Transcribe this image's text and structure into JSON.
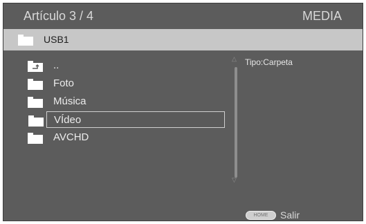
{
  "header": {
    "title": "Artículo 3 / 4",
    "mode": "MEDIA"
  },
  "path": {
    "label": "USB1",
    "icon": "folder-icon"
  },
  "items": [
    {
      "label": "..",
      "icon": "parent-folder-icon"
    },
    {
      "label": "Foto",
      "icon": "folder-icon"
    },
    {
      "label": "Música",
      "icon": "folder-icon"
    },
    {
      "label": "VÍdeo",
      "icon": "folder-icon",
      "selected": true
    },
    {
      "label": "AVCHD",
      "icon": "folder-icon"
    }
  ],
  "info": {
    "type_text": "Tipo:Carpeta"
  },
  "footer": {
    "home_button": "HOME",
    "home_label": "Salir"
  },
  "colors": {
    "background": "#5c5c5c",
    "path_bar": "#c7c7c7",
    "text": "#ececec"
  }
}
